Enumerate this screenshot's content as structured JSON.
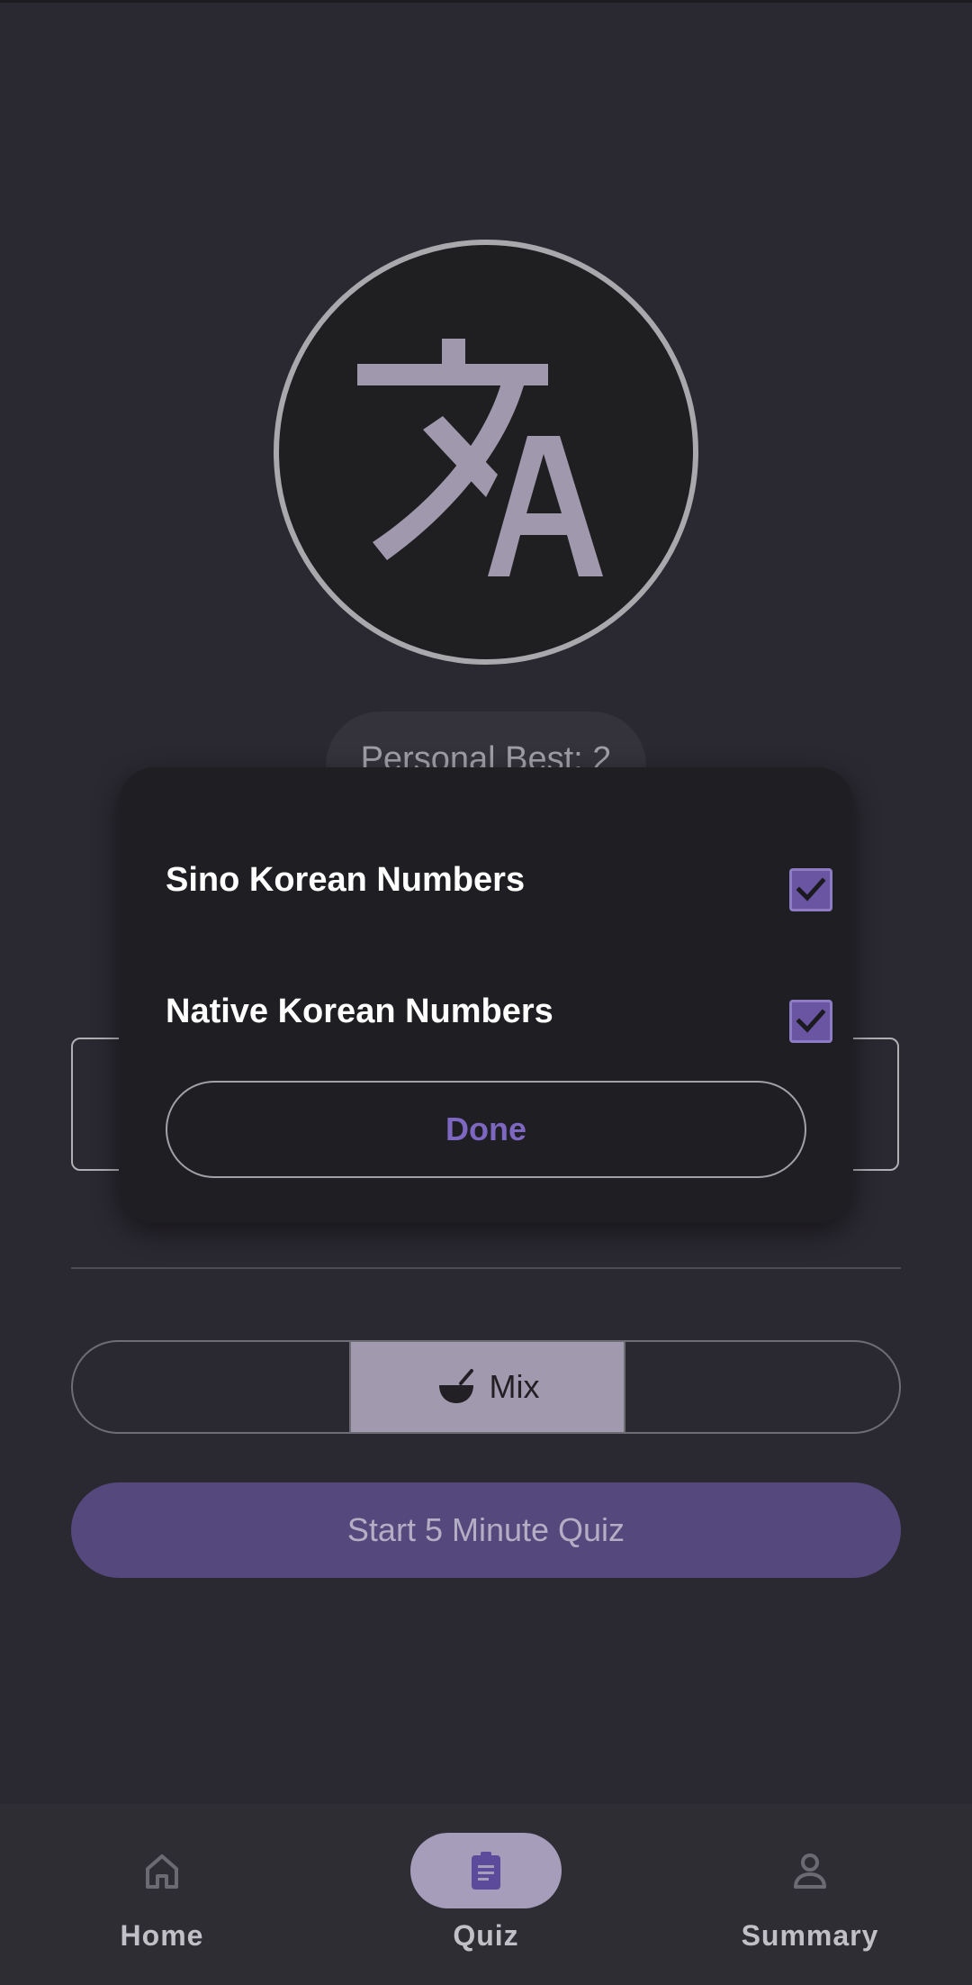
{
  "app": {
    "logo_icon": "translate-icon",
    "personal_best": "Personal Best: 2"
  },
  "dialog": {
    "options": [
      {
        "label": "Sino Korean Numbers",
        "checked": true
      },
      {
        "label": "Native Korean Numbers",
        "checked": true
      }
    ],
    "done_label": "Done"
  },
  "mode_selector": {
    "selected": "Mix",
    "selected_icon": "bowl-icon",
    "segments": [
      "",
      "Mix",
      ""
    ]
  },
  "start_button_label": "Start 5 Minute Quiz",
  "bottom_nav": {
    "items": [
      {
        "label": "Home",
        "icon": "home-icon"
      },
      {
        "label": "Quiz",
        "icon": "clipboard-icon",
        "active": true
      },
      {
        "label": "Summary",
        "icon": "person-icon"
      }
    ]
  },
  "colors": {
    "background": "#2a2830",
    "accent": "#54487d",
    "checkbox": "#6a55a3",
    "done_text": "#7d67c1"
  }
}
